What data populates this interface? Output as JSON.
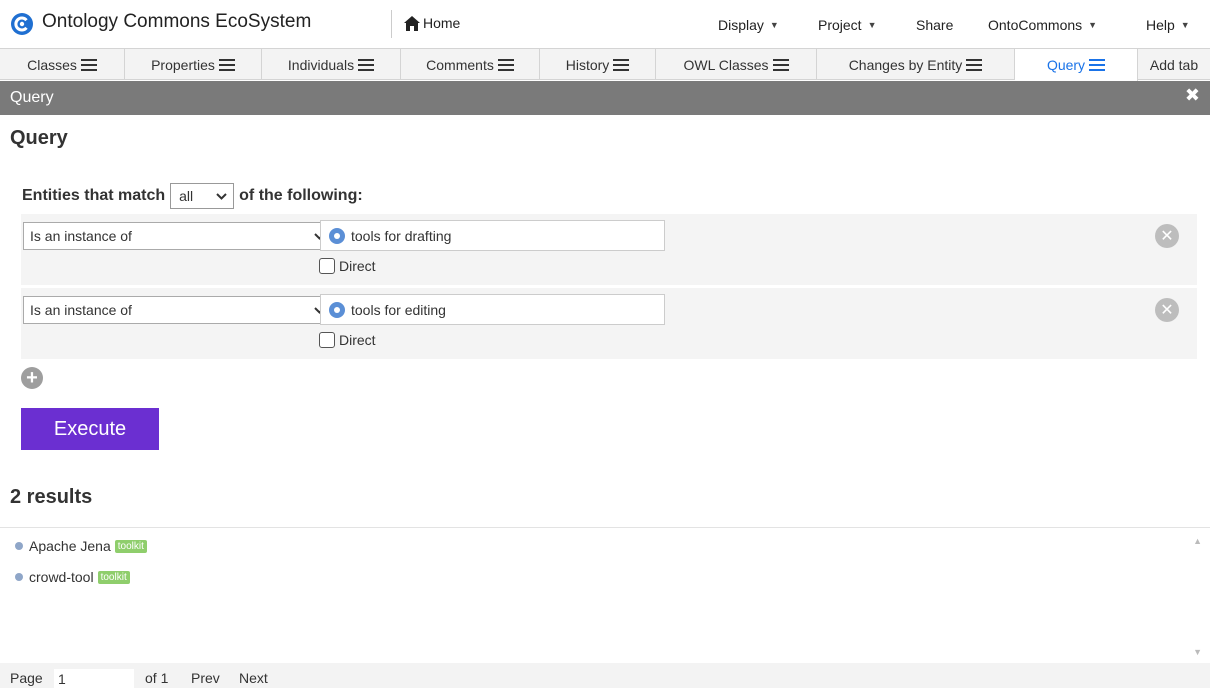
{
  "app": {
    "title": "Ontology Commons EcoSystem",
    "home_label": "Home",
    "accent_color": "#1a73e8",
    "logo_icon": "ontocommons-logo-icon"
  },
  "top_menu": [
    {
      "label": "Display",
      "has_caret": true
    },
    {
      "label": "Project",
      "has_caret": true
    },
    {
      "label": "Share",
      "has_caret": false
    },
    {
      "label": "OntoCommons",
      "has_caret": true
    },
    {
      "label": "Help",
      "has_caret": true
    }
  ],
  "tabs": [
    {
      "label": "Classes",
      "active": false
    },
    {
      "label": "Properties",
      "active": false
    },
    {
      "label": "Individuals",
      "active": false
    },
    {
      "label": "Comments",
      "active": false
    },
    {
      "label": "History",
      "active": false
    },
    {
      "label": "OWL Classes",
      "active": false
    },
    {
      "label": "Changes by Entity",
      "active": false
    },
    {
      "label": "Query",
      "active": true
    }
  ],
  "add_tab_label": "Add tab",
  "panel": {
    "title": "Query",
    "close_icon": "close-icon"
  },
  "query": {
    "heading": "Query",
    "match_prefix": "Entities that match",
    "match_value": "all",
    "match_suffix": "of the following:",
    "criteria": [
      {
        "type": "Is an instance of",
        "value": "tools for drafting",
        "direct_label": "Direct",
        "direct_checked": false
      },
      {
        "type": "Is an instance of",
        "value": "tools for editing",
        "direct_label": "Direct",
        "direct_checked": false
      }
    ],
    "execute_label": "Execute",
    "execute_color": "#6b2fd1"
  },
  "results": {
    "count_label": "2 results",
    "items": [
      {
        "name": "Apache Jena",
        "tag": "toolkit"
      },
      {
        "name": "crowd-tool",
        "tag": "toolkit"
      }
    ],
    "tag_color": "#8fce6c"
  },
  "pager": {
    "page_label": "Page",
    "page_value": "1",
    "of_label": "of 1",
    "prev_label": "Prev",
    "next_label": "Next"
  }
}
